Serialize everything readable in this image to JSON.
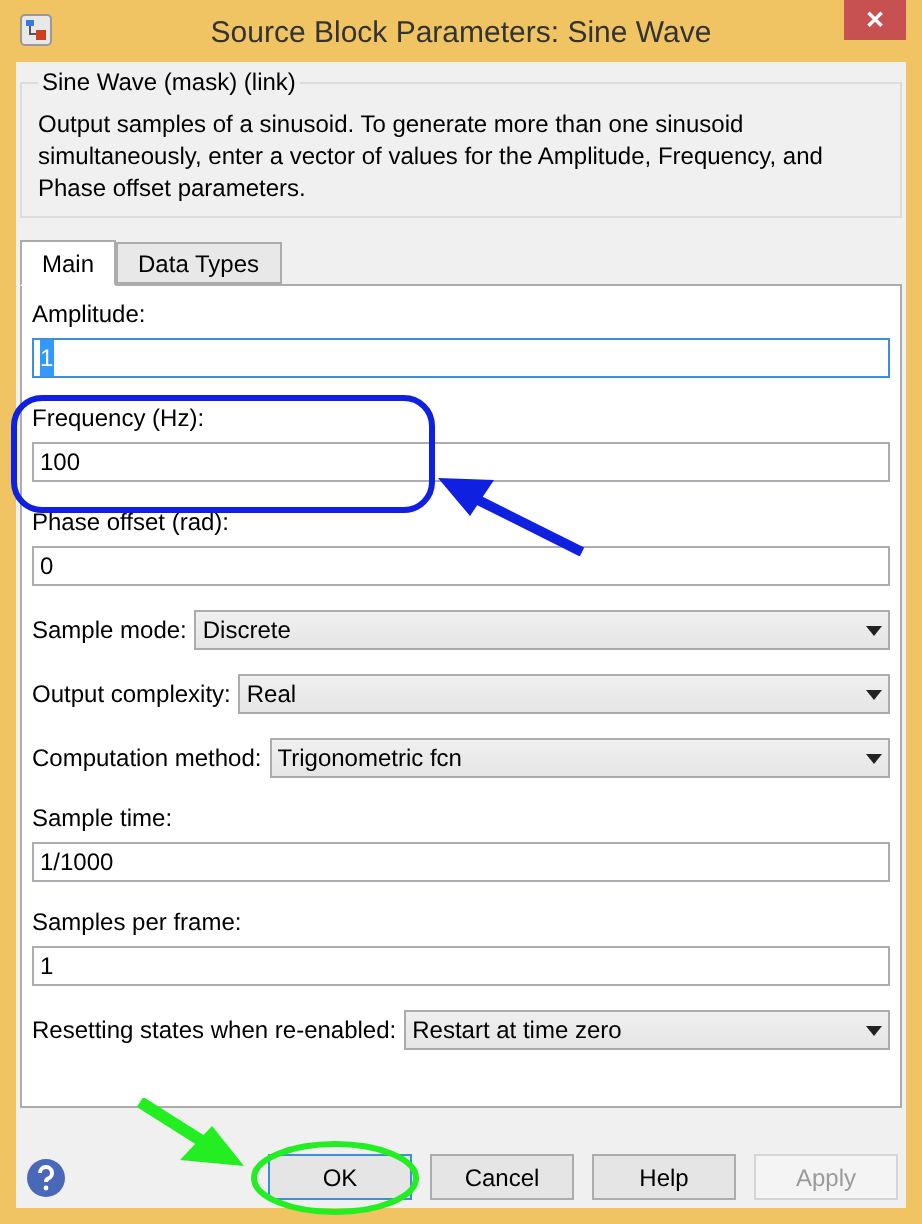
{
  "window": {
    "title": "Source Block Parameters: Sine Wave",
    "close": "✕"
  },
  "group": {
    "title": "Sine Wave (mask) (link)",
    "description": "Output samples of a sinusoid.  To generate more than one sinusoid simultaneously, enter a vector of values for the Amplitude, Frequency, and Phase offset parameters."
  },
  "tabs": [
    {
      "label": "Main",
      "selected": true
    },
    {
      "label": "Data Types",
      "selected": false
    }
  ],
  "parameters": [
    {
      "kind": "text",
      "label": "Amplitude:",
      "value": "1",
      "focused": true
    },
    {
      "kind": "text",
      "label": "Frequency (Hz):",
      "value": "100",
      "focused": false
    },
    {
      "kind": "text",
      "label": "Phase offset (rad):",
      "value": "0",
      "focused": false
    },
    {
      "kind": "dropdown",
      "label": "Sample mode:",
      "value": "Discrete"
    },
    {
      "kind": "dropdown",
      "label": "Output complexity:",
      "value": "Real"
    },
    {
      "kind": "dropdown",
      "label": "Computation method:",
      "value": "Trigonometric fcn"
    },
    {
      "kind": "text",
      "label": "Sample time:",
      "value": "1/1000",
      "focused": false
    },
    {
      "kind": "text",
      "label": "Samples per frame:",
      "value": "1",
      "focused": false
    },
    {
      "kind": "dropdown",
      "label": "Resetting states when re-enabled:",
      "value": "Restart at time zero"
    }
  ],
  "buttons": [
    {
      "label": "OK",
      "disabled": false
    },
    {
      "label": "Cancel",
      "disabled": false
    },
    {
      "label": "Help",
      "disabled": false
    },
    {
      "label": "Apply",
      "disabled": true
    }
  ]
}
